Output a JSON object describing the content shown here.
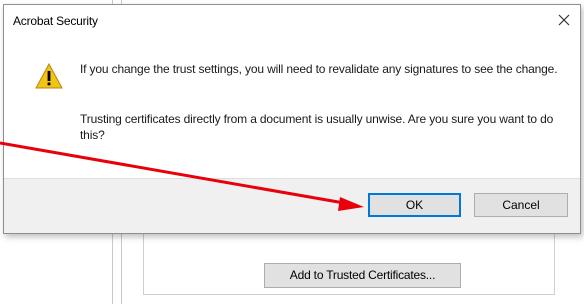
{
  "dialog": {
    "title": "Acrobat Security",
    "message_line1": "If you change the trust settings, you will need to revalidate any signatures to see the change.",
    "message_line2": "Trusting certificates directly from a document is usually unwise. Are you sure you want to do this?",
    "ok_label": "OK",
    "cancel_label": "Cancel",
    "close_icon": "close-icon",
    "warning_icon": "warning-triangle-icon"
  },
  "background": {
    "add_trusted_button_label": "Add to Trusted Certificates..."
  },
  "annotation": {
    "color": "#e8000b"
  },
  "colors": {
    "ok_focus_border": "#0078d7",
    "warning_yellow": "#f2c318"
  }
}
